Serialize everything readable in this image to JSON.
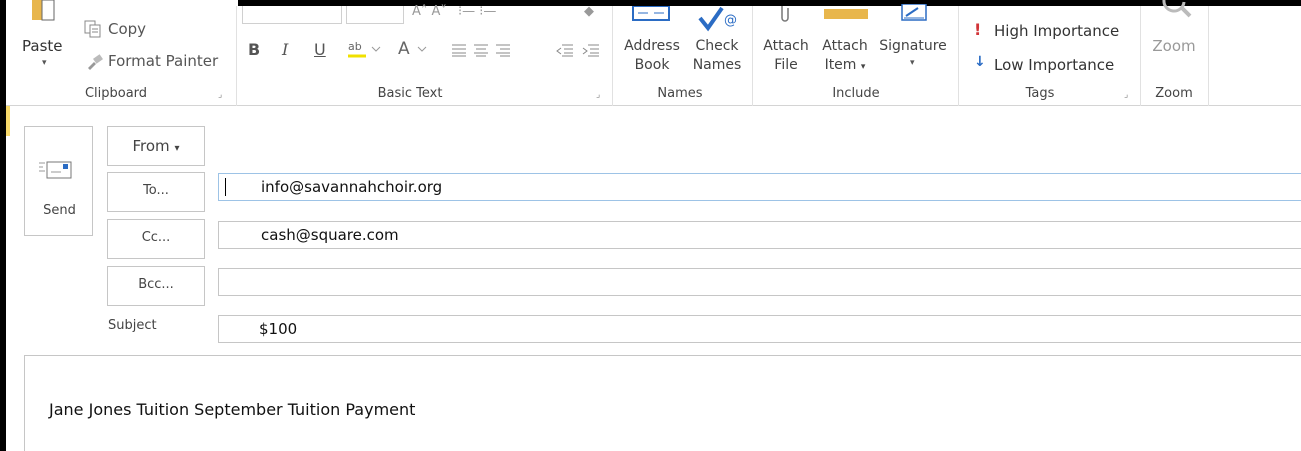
{
  "ribbon": {
    "clipboard": {
      "paste_label": "Paste",
      "copy_label": "Copy",
      "format_painter_label": "Format Painter",
      "group_label": "Clipboard"
    },
    "basic_text": {
      "bold": "B",
      "italic": "I",
      "underline": "U",
      "group_label": "Basic Text"
    },
    "names": {
      "address_book_line1": "Address",
      "address_book_line2": "Book",
      "check_names_line1": "Check",
      "check_names_line2": "Names",
      "group_label": "Names"
    },
    "include": {
      "attach_file_line1": "Attach",
      "attach_file_line2": "File",
      "attach_item_line1": "Attach",
      "attach_item_line2": "Item",
      "signature_label": "Signature",
      "group_label": "Include"
    },
    "tags": {
      "high_importance": "High Importance",
      "low_importance": "Low Importance",
      "group_label": "Tags"
    },
    "zoom": {
      "zoom_button": "Zoom",
      "group_label": "Zoom"
    }
  },
  "compose": {
    "send_label": "Send",
    "from_label": "From",
    "to_label": "To...",
    "cc_label": "Cc...",
    "bcc_label": "Bcc...",
    "subject_label": "Subject",
    "to_value": "info@savannahchoir.org",
    "cc_value": "cash@square.com",
    "bcc_value": "",
    "subject_value": "$100",
    "body_text": "Jane Jones Tuition September Tuition Payment"
  },
  "colors": {
    "accent_blue": "#2b6cc4",
    "importance_red": "#d13438",
    "folder_yellow": "#e8b64c"
  }
}
